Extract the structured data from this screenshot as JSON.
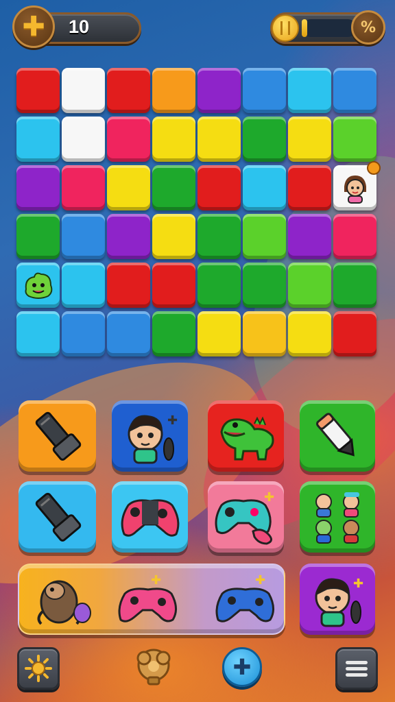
{
  "hud": {
    "left_value": "10",
    "left_badge_icon": "plus-icon",
    "right_coin_icon": "coin-icon",
    "right_meter_fill": 0.1,
    "right_badge_icon": "percent-icon",
    "right_badge_glyph": "%"
  },
  "board": {
    "rows": 6,
    "cols": 8,
    "colors": {
      "red": "#e11d1d",
      "white": "#f7f7f7",
      "orange": "#f79a1b",
      "purple": "#8e24c9",
      "blue": "#2f8ae0",
      "cyan": "#2cc3ee",
      "pink": "#f0245e",
      "yellow": "#f5dd12",
      "green": "#1ea92c",
      "lime": "#5bd12b",
      "gold": "#f7c21a"
    },
    "tiles": [
      [
        "red",
        "white",
        "red",
        "orange",
        "purple",
        "blue",
        "cyan",
        "blue"
      ],
      [
        "cyan",
        "white",
        "pink",
        "yellow",
        "yellow",
        "green",
        "yellow",
        "lime"
      ],
      [
        "purple",
        "pink",
        "yellow",
        "green",
        "red",
        "cyan",
        "red",
        "white"
      ],
      [
        "green",
        "blue",
        "purple",
        "yellow",
        "green",
        "lime",
        "purple",
        "pink"
      ],
      [
        "cyan",
        "cyan",
        "red",
        "red",
        "green",
        "green",
        "lime",
        "green"
      ],
      [
        "cyan",
        "blue",
        "blue",
        "green",
        "yellow",
        "gold",
        "yellow",
        "red"
      ]
    ],
    "special_tiles": [
      {
        "row": 2,
        "col": 7,
        "icon": "girl-avatar-icon"
      },
      {
        "row": 4,
        "col": 0,
        "icon": "green-monster-icon"
      }
    ]
  },
  "cards": [
    {
      "name": "card-flashlight-orange",
      "color": "#f79a1b",
      "icon": "flashlight-icon"
    },
    {
      "name": "card-boy-blue",
      "color": "#1f5fd0",
      "icon": "boy-avatar-icon"
    },
    {
      "name": "card-dino-red",
      "color": "#e6231f",
      "icon": "dinosaur-icon"
    },
    {
      "name": "card-pencil-green",
      "color": "#2fb52a",
      "icon": "pencil-icon"
    },
    {
      "name": "card-flashlight-cyan",
      "color": "#34b9ef",
      "icon": "flashlight-icon"
    },
    {
      "name": "card-gamepad-cyan",
      "color": "#3cc6f2",
      "icon": "gamepad-icon"
    },
    {
      "name": "card-gamepad-pink",
      "color": "#f27a9a",
      "icon": "gamepad-icon"
    },
    {
      "name": "card-kids-green",
      "color": "#2fb52a",
      "icon": "kids-group-icon"
    }
  ],
  "tray": {
    "items": [
      "sloth-icon",
      "pink-gamepad-icon",
      "blue-gamepad-icon"
    ]
  },
  "side_card": {
    "name": "card-boy-purple",
    "color": "#9b2ad1",
    "icon": "boy-avatar-icon"
  },
  "nav": [
    "settings-sun-icon",
    "trophy-icon",
    "add-icon",
    "menu-icon"
  ]
}
